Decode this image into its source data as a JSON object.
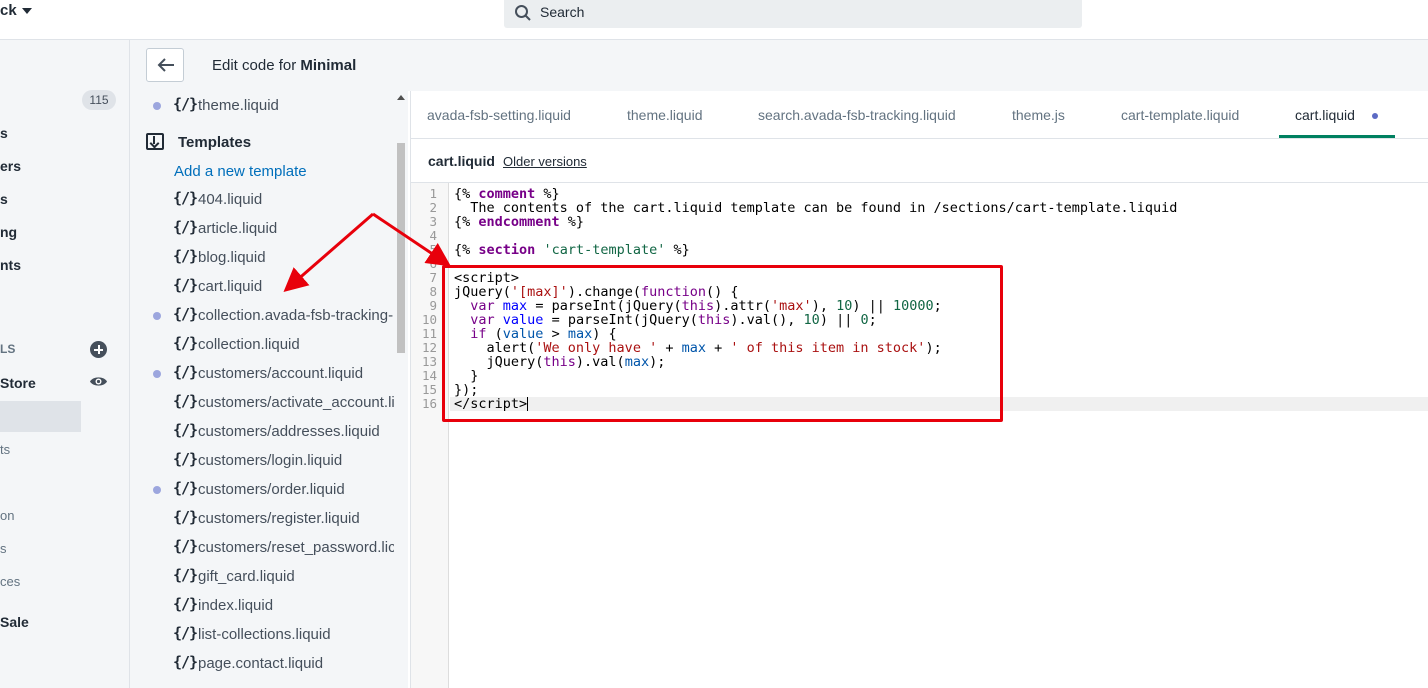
{
  "topbar": {
    "store_name": "ck",
    "search_placeholder": "Search"
  },
  "admin_nav": {
    "badge": "115",
    "fragments": [
      "s",
      "ers",
      "s",
      "ng",
      "nts"
    ],
    "section_label": "LS",
    "store_label": "Store",
    "sub_fragments": [
      "ts",
      "on",
      "s",
      "ces"
    ],
    "sale_label": "Sale"
  },
  "header": {
    "title_prefix": "Edit code for ",
    "theme_name": "Minimal"
  },
  "file_tree": {
    "top_file": "theme.liquid",
    "folder_label": "Templates",
    "add_link": "Add a new template",
    "glyph": "{/}",
    "files": [
      "404.liquid",
      "article.liquid",
      "blog.liquid",
      "cart.liquid",
      "collection.avada-fsb-tracking-",
      "collection.liquid",
      "customers/account.liquid",
      "customers/activate_account.li",
      "customers/addresses.liquid",
      "customers/login.liquid",
      "customers/order.liquid",
      "customers/register.liquid",
      "customers/reset_password.lic",
      "gift_card.liquid",
      "index.liquid",
      "list-collections.liquid",
      "page.contact.liquid"
    ]
  },
  "tabs": [
    "avada-fsb-setting.liquid",
    "theme.liquid",
    "search.avada-fsb-tracking.liquid",
    "theme.js",
    "cart-template.liquid",
    "cart.liquid"
  ],
  "active_tab": "cart.liquid",
  "file_bar": {
    "file_name": "cart.liquid",
    "older_versions": "Older versions"
  },
  "code": {
    "line_numbers": [
      "1",
      "2",
      "3",
      "4",
      "5",
      "6",
      "7",
      "8",
      "9",
      "10",
      "11",
      "12",
      "13",
      "14",
      "15",
      "16"
    ]
  }
}
